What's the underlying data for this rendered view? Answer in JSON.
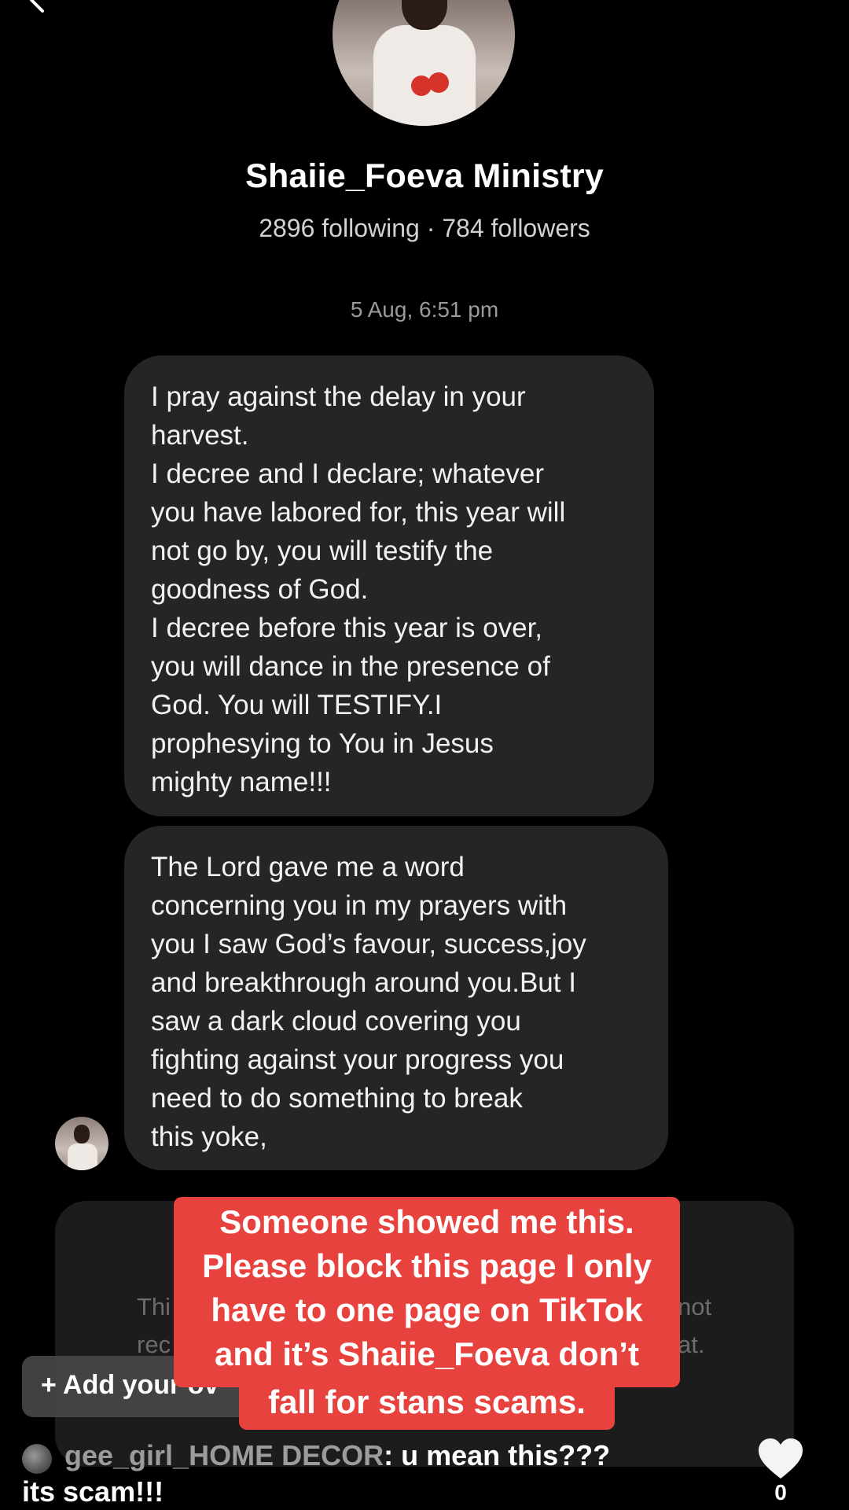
{
  "profile": {
    "name": "Shaiie_Foeva Ministry",
    "stats": "2896 following · 784 followers"
  },
  "chat": {
    "timestamp": "5 Aug, 6:51 pm",
    "messages": [
      {
        "lines": [
          "I pray against the delay in your",
          "harvest.",
          "I decree and I declare; whatever",
          "you have labored for, this year will",
          "not go by, you will testify the",
          "goodness of God.",
          "I decree before this year is over,",
          "you will dance in the presence of",
          "God. You will TESTIFY.I",
          "prophesying to You in Jesus",
          "mighty name!!!"
        ]
      },
      {
        "lines": [
          "The Lord gave me a word",
          "concerning you in my prayers with",
          "you I saw God’s favour, success,joy",
          "and breakthrough around you.But I",
          "saw a dark cloud covering you",
          "fighting against your progress you",
          "need to do something to break",
          "this yoke,"
        ]
      }
    ],
    "notice_fragments": {
      "left": [
        "Thi",
        "rec"
      ],
      "right": [
        "not",
        "at."
      ]
    }
  },
  "add_yours": {
    "label": "+ Add your ov"
  },
  "caption": {
    "lines": [
      "Someone showed me this.",
      "Please block this page I only",
      "have to one page on TikTok",
      "and it’s Shaiie_Foeva  don’t"
    ],
    "last_line": "fall for stans scams."
  },
  "comment": {
    "username": "gee_girl_HOME DECOR",
    "text": ": u mean this???",
    "text_line2": "its scam!!!",
    "like_count": "0"
  },
  "colors": {
    "background": "#000000",
    "bubble": "#252525",
    "caption_red": "#e8423f",
    "muted_text": "#9a9a9a"
  },
  "icons": {
    "back": "chevron-left-icon",
    "like": "heart-icon"
  }
}
